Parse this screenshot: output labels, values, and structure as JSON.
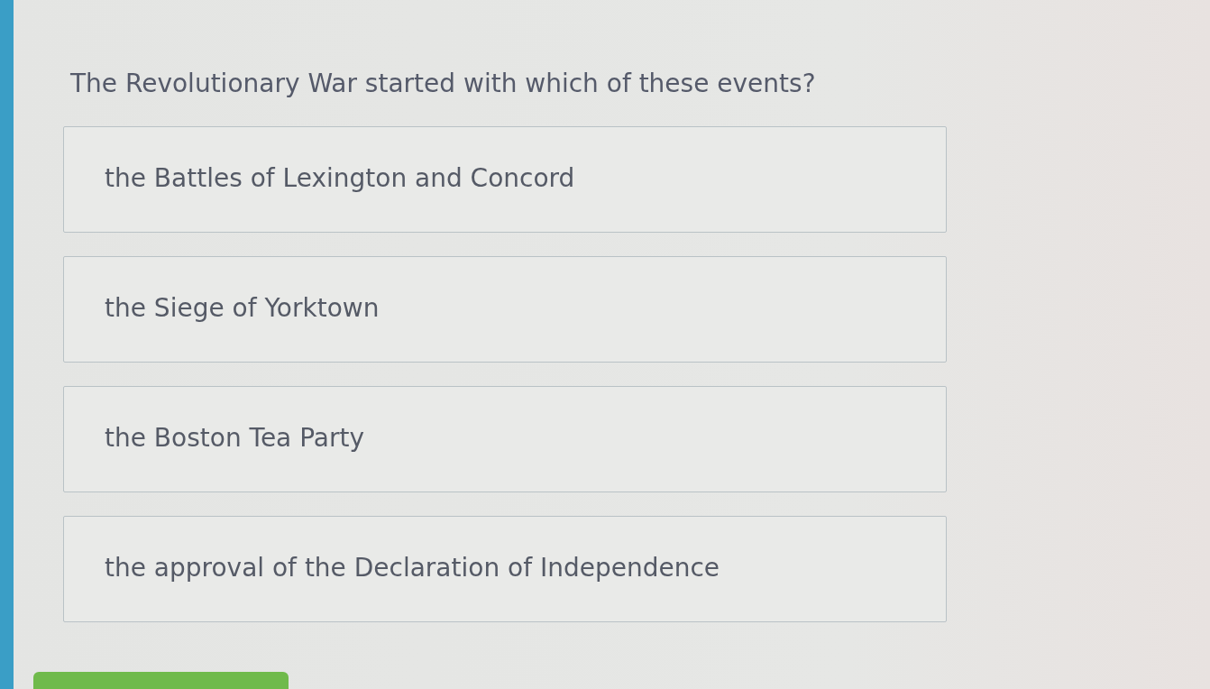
{
  "question": {
    "text": "The Revolutionary War started with which of these events?"
  },
  "options": [
    {
      "label": "the Battles of Lexington and Concord",
      "selected": false
    },
    {
      "label": "the Siege of Yorktown",
      "selected": false
    },
    {
      "label": "the Boston Tea Party",
      "selected": false
    },
    {
      "label": "the approval of the Declaration of Independence",
      "selected": false
    }
  ],
  "submit_button": {
    "disabled": false
  }
}
